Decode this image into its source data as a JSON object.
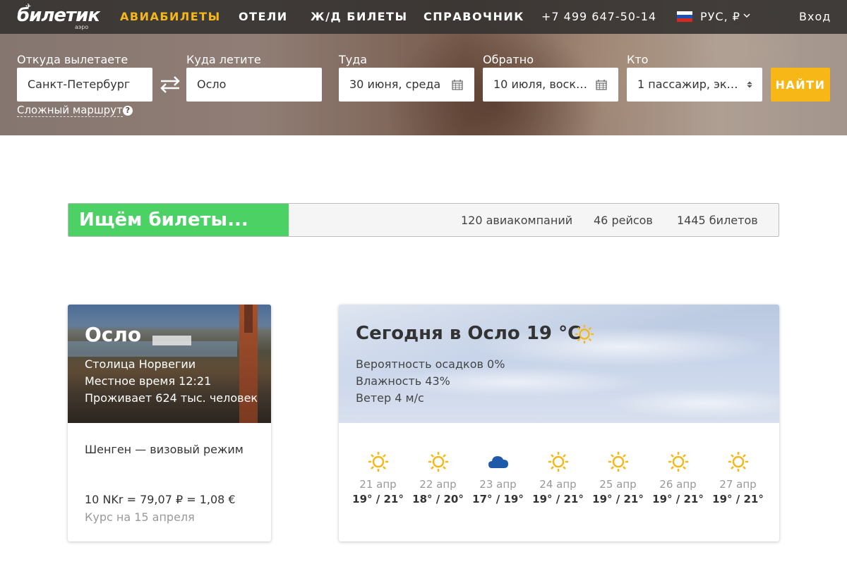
{
  "header": {
    "logo": {
      "name": "билетик",
      "sub": "аэро"
    },
    "nav": [
      {
        "label": "АВИАБИЛЕТЫ",
        "active": true
      },
      {
        "label": "ОТЕЛИ",
        "active": false
      },
      {
        "label": "Ж/Д БИЛЕТЫ",
        "active": false
      },
      {
        "label": "СПРАВОЧНИК",
        "active": false
      }
    ],
    "phone": "+7 499 647-50-14",
    "language": {
      "label": "РУС, ₽",
      "flag": "russia-flag-icon"
    },
    "login": "Вход"
  },
  "search": {
    "from": {
      "label": "Откуда вылетаете",
      "value": "Санкт-Петербург"
    },
    "to": {
      "label": "Куда летите",
      "value": "Осло"
    },
    "depart": {
      "label": "Туда",
      "value": "30 июня, среда"
    },
    "return": {
      "label": "Обратно",
      "value": "10 июля, воскр..."
    },
    "who": {
      "label": "Кто",
      "value": "1 пассажир, экон..."
    },
    "find_button": "НАЙТИ",
    "complex_route": "Сложный маршрут"
  },
  "progress": {
    "title": "Ищём билеты...",
    "fraction": 0.31,
    "stats": [
      "120 авиакомпаний",
      "46 рейсов",
      "1445 билетов"
    ]
  },
  "city": {
    "name": "Осло",
    "lines": [
      "Столица Норвегии",
      "Местное время 12:21",
      "Проживает 624 тыс. человек"
    ],
    "visa": "Шенген — визовый режим",
    "rate": "10 NKr = 79,07 ₽ = 1,08 €",
    "rate_date": "Курс на 15 апреля"
  },
  "weather": {
    "title": "Сегодня в Осло 19 °C",
    "lines": [
      "Вероятность осадков 0%",
      "Влажность 43%",
      "Ветер 4 м/с"
    ],
    "forecast": [
      {
        "date": "21 апр",
        "temp": "19° / 21°",
        "icon": "sun-icon"
      },
      {
        "date": "22 апр",
        "temp": "18° / 20°",
        "icon": "sun-icon"
      },
      {
        "date": "23 апр",
        "temp": "17° / 19°",
        "icon": "cloud-icon"
      },
      {
        "date": "24 апр",
        "temp": "19° / 21°",
        "icon": "sun-icon"
      },
      {
        "date": "25 апр",
        "temp": "19° / 21°",
        "icon": "sun-icon"
      },
      {
        "date": "26 апр",
        "temp": "19° / 21°",
        "icon": "sun-icon"
      },
      {
        "date": "27 апр",
        "temp": "19° / 21°",
        "icon": "sun-icon"
      }
    ]
  },
  "colors": {
    "accent": "#f7b817",
    "progress": "#4cd264",
    "cloud": "#1e5aa8"
  }
}
